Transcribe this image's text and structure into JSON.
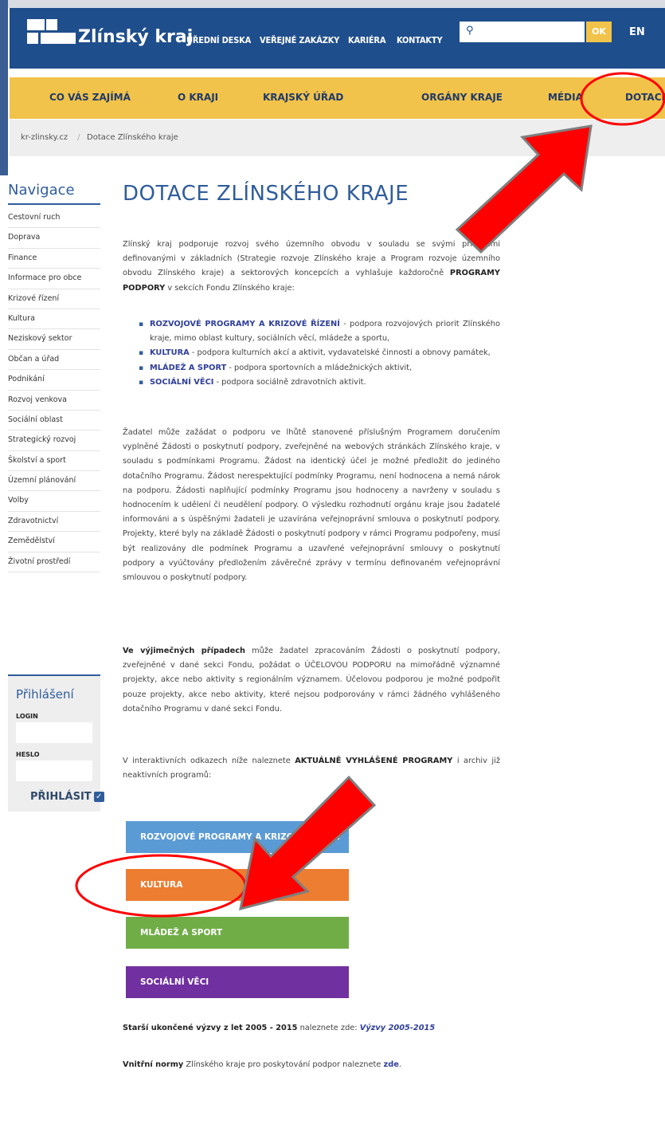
{
  "header": {
    "logo_text": "Zlínský kraj",
    "top_links": [
      "ÚŘEDNÍ DESKA",
      "VEŘEJNÉ ZAKÁZKY",
      "KARIÉRA",
      "KONTAKTY"
    ],
    "search_placeholder": "",
    "search_button": "OK",
    "language": "EN"
  },
  "main_nav": [
    "CO VÁS ZAJÍMÁ",
    "O KRAJI",
    "KRAJSKÝ ÚŘAD",
    "ORGÁNY KRAJE",
    "MÉDIA",
    "DOTACE"
  ],
  "breadcrumb": {
    "home": "kr-zlinsky.cz",
    "separator": "/",
    "current": "Dotace Zlínského kraje"
  },
  "sidebar": {
    "title": "Navigace",
    "items": [
      "Cestovní ruch",
      "Doprava",
      "Finance",
      "Informace pro obce",
      "Krizové řízení",
      "Kultura",
      "Neziskový sektor",
      "Občan a úřad",
      "Podnikání",
      "Rozvoj venkova",
      "Sociální oblast",
      "Strategický rozvoj",
      "Školství a sport",
      "Územní plánování",
      "Volby",
      "Zdravotnictví",
      "Zemědělství",
      "Životní prostředí"
    ]
  },
  "login": {
    "title": "Přihlášení",
    "login_label": "LOGIN",
    "password_label": "HESLO",
    "button": "PŘIHLÁSIT"
  },
  "content": {
    "title": "DOTACE ZLÍNSKÉHO KRAJE",
    "intro_text": "Zlínský kraj podporuje rozvoj svého územního obvodu v souladu se svými prioritami definovanými v základních (Strategie rozvoje Zlínského kraje a Program rozvoje územního obvodu Zlínského kraje) a sektorových koncepcích a vyhlašuje každoročně",
    "intro_bold": "PROGRAMY PODPORY",
    "intro_tail": "v sekcích Fondu Zlínského kraje:",
    "bullets": [
      {
        "label": "ROZVOJOVÉ PROGRAMY A KRIZOVÉ ŘÍZENÍ",
        "text": " - podpora rozvojových priorit Zlínského kraje, mimo oblast kultury, sociálních věcí, mládeže a sportu,"
      },
      {
        "label": "KULTURA",
        "text": " - podpora kulturních akcí a aktivit, vydavatelské činnosti a obnovy památek,"
      },
      {
        "label": "MLÁDEŽ A SPORT",
        "text": " - podpora sportovních a mládežnických aktivit,"
      },
      {
        "label": "SOCIÁLNÍ VĚCI",
        "text": " - podpora sociálně zdravotních aktivit."
      }
    ],
    "para2": "Žadatel může zažádat o podporu ve lhůtě stanovené příslušným Programem doručením vyplněné Žádosti o poskytnutí podpory, zveřejněné na webových stránkách Zlínského kraje, v souladu s podmínkami Programu. Žádost na identický účel je možné předložit do jediného dotačního Programu. Žádost nerespektující podmínky Programu, není hodnocena a nemá nárok na podporu. Žádosti naplňující podmínky Programu jsou hodnoceny a navrženy v souladu s hodnocením k udělení či neudělení podpory. O výsledku rozhodnutí orgánu kraje jsou žadatelé informováni a s úspěšnými žadateli je uzavírána veřejnoprávní smlouva o poskytnutí podpory. Projekty, které byly na základě Žádosti o poskytnutí podpory v rámci Programu podpořeny, musí být realizovány dle podmínek Programu a uzavřené veřejnoprávní smlouvy o poskytnutí podpory a vyúčtovány předložením závěrečné zprávy v termínu definovaném veřejnoprávní smlouvou o poskytnutí podpory.",
    "para3_bold": "Ve výjimečných případech",
    "para3": " může žadatel zpracováním Žádosti o poskytnutí podpory, zveřejněné v dané sekci Fondu, požádat o ÚČELOVOU PODPORU na mimořádně významné projekty, akce nebo aktivity s regionálním významem. Účelovou podporou je možné podpořit pouze projekty, akce nebo aktivity, které nejsou podporovány v rámci žádného vyhlášeného dotačního Programu v dané sekci Fondu.",
    "para4_pre": "V interaktivních odkazech níže naleznete ",
    "para4_bold": "AKTUÁLNĚ VYHLÁŠENÉ PROGRAMY",
    "para4_post": " i archiv již neaktivních programů:",
    "program_buttons": [
      {
        "label": "ROZVOJOVÉ PROGRAMY A KRIZOVÉ ŘÍZENÍ",
        "color": "#5b9bd5"
      },
      {
        "label": "KULTURA",
        "color": "#ed7d31"
      },
      {
        "label": "MLÁDEŽ A SPORT",
        "color": "#70ad47"
      },
      {
        "label": "SOCIÁLNÍ VĚCI",
        "color": "#7030a0"
      }
    ],
    "older_bold": "Starší ukončené výzvy z let 2005 - 2015",
    "older_mid": " naleznete zde: ",
    "older_link": "Výzvy 2005-2015",
    "norms_bold": "Vnitřní normy",
    "norms_mid": " Zlínského kraje pro poskytování podpor naleznete ",
    "norms_link": "zde",
    "norms_end": "."
  },
  "colors": {
    "header_blue": "#1f4e8c",
    "nav_yellow": "#f2c34a",
    "annotation_red": "#ff0000"
  }
}
